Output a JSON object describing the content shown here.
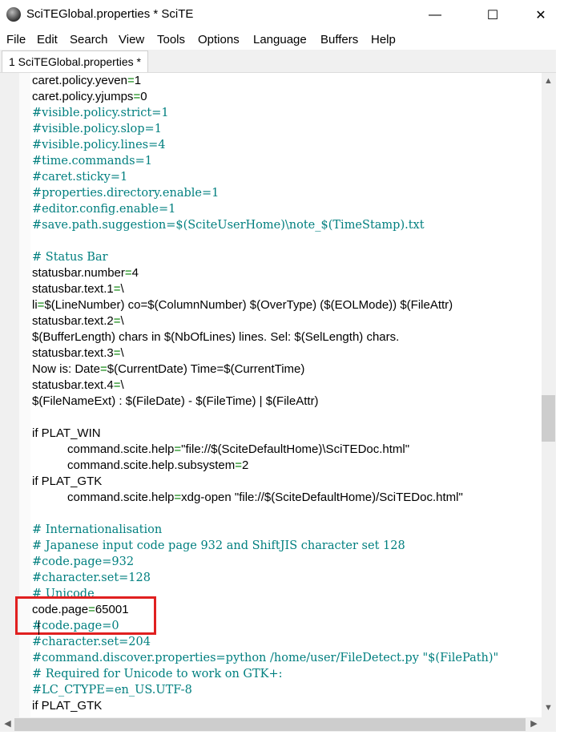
{
  "window": {
    "title": "SciTEGlobal.properties * SciTE",
    "minimize": "—",
    "maximize": "☐",
    "close": "✕"
  },
  "menu": [
    "File",
    "Edit",
    "Search",
    "View",
    "Tools",
    "Options",
    "Language",
    "Buffers",
    "Help"
  ],
  "tab": {
    "label": "1 SciTEGlobal.properties *"
  },
  "scroll": {
    "up": "▲",
    "down": "▼",
    "left": "◀",
    "right": "▶"
  },
  "lines": [
    {
      "text": "caret.policy.yeven=1",
      "kind": "code"
    },
    {
      "text": "caret.policy.yjumps=0",
      "kind": "code"
    },
    {
      "text": "#visible.policy.strict=1",
      "kind": "comment"
    },
    {
      "text": "#visible.policy.slop=1",
      "kind": "comment"
    },
    {
      "text": "#visible.policy.lines=4",
      "kind": "comment"
    },
    {
      "text": "#time.commands=1",
      "kind": "comment"
    },
    {
      "text": "#caret.sticky=1",
      "kind": "comment"
    },
    {
      "text": "#properties.directory.enable=1",
      "kind": "comment"
    },
    {
      "text": "#editor.config.enable=1",
      "kind": "comment"
    },
    {
      "text": "#save.path.suggestion=$(SciteUserHome)\\note_$(TimeStamp).txt",
      "kind": "comment"
    },
    {
      "text": "",
      "kind": "code"
    },
    {
      "text": "# Status Bar",
      "kind": "comment"
    },
    {
      "text": "statusbar.number=4",
      "kind": "code"
    },
    {
      "text": "statusbar.text.1=\\",
      "kind": "code"
    },
    {
      "text": "li=$(LineNumber) co=$(ColumnNumber) $(OverType) ($(EOLMode)) $(FileAttr)",
      "kind": "code"
    },
    {
      "text": "statusbar.text.2=\\",
      "kind": "code"
    },
    {
      "text": "$(BufferLength) chars in $(NbOfLines) lines. Sel: $(SelLength) chars.",
      "kind": "code"
    },
    {
      "text": "statusbar.text.3=\\",
      "kind": "code"
    },
    {
      "text": "Now is: Date=$(CurrentDate) Time=$(CurrentTime)",
      "kind": "code"
    },
    {
      "text": "statusbar.text.4=\\",
      "kind": "code"
    },
    {
      "text": "$(FileNameExt) : $(FileDate) - $(FileTime) | $(FileAttr)",
      "kind": "code"
    },
    {
      "text": "",
      "kind": "code"
    },
    {
      "text": "if PLAT_WIN",
      "kind": "code"
    },
    {
      "text": "\tcommand.scite.help=\"file://$(SciteDefaultHome)\\SciTEDoc.html\"",
      "kind": "code"
    },
    {
      "text": "\tcommand.scite.help.subsystem=2",
      "kind": "code"
    },
    {
      "text": "if PLAT_GTK",
      "kind": "code"
    },
    {
      "text": "\tcommand.scite.help=xdg-open \"file://$(SciteDefaultHome)/SciTEDoc.html\"",
      "kind": "code"
    },
    {
      "text": "",
      "kind": "code"
    },
    {
      "text": "# Internationalisation",
      "kind": "comment"
    },
    {
      "text": "# Japanese input code page 932 and ShiftJIS character set 128",
      "kind": "comment"
    },
    {
      "text": "#code.page=932",
      "kind": "comment"
    },
    {
      "text": "#character.set=128",
      "kind": "comment"
    },
    {
      "text": "# Unicode",
      "kind": "comment"
    },
    {
      "text": "code.page=65001",
      "kind": "code"
    },
    {
      "text": "#code.page=0",
      "kind": "comment"
    },
    {
      "text": "#character.set=204",
      "kind": "comment"
    },
    {
      "text": "#command.discover.properties=python /home/user/FileDetect.py \"$(FilePath)\"",
      "kind": "comment"
    },
    {
      "text": "# Required for Unicode to work on GTK+:",
      "kind": "comment"
    },
    {
      "text": "#LC_CTYPE=en_US.UTF-8",
      "kind": "comment"
    },
    {
      "text": "if PLAT_GTK",
      "kind": "code"
    }
  ]
}
